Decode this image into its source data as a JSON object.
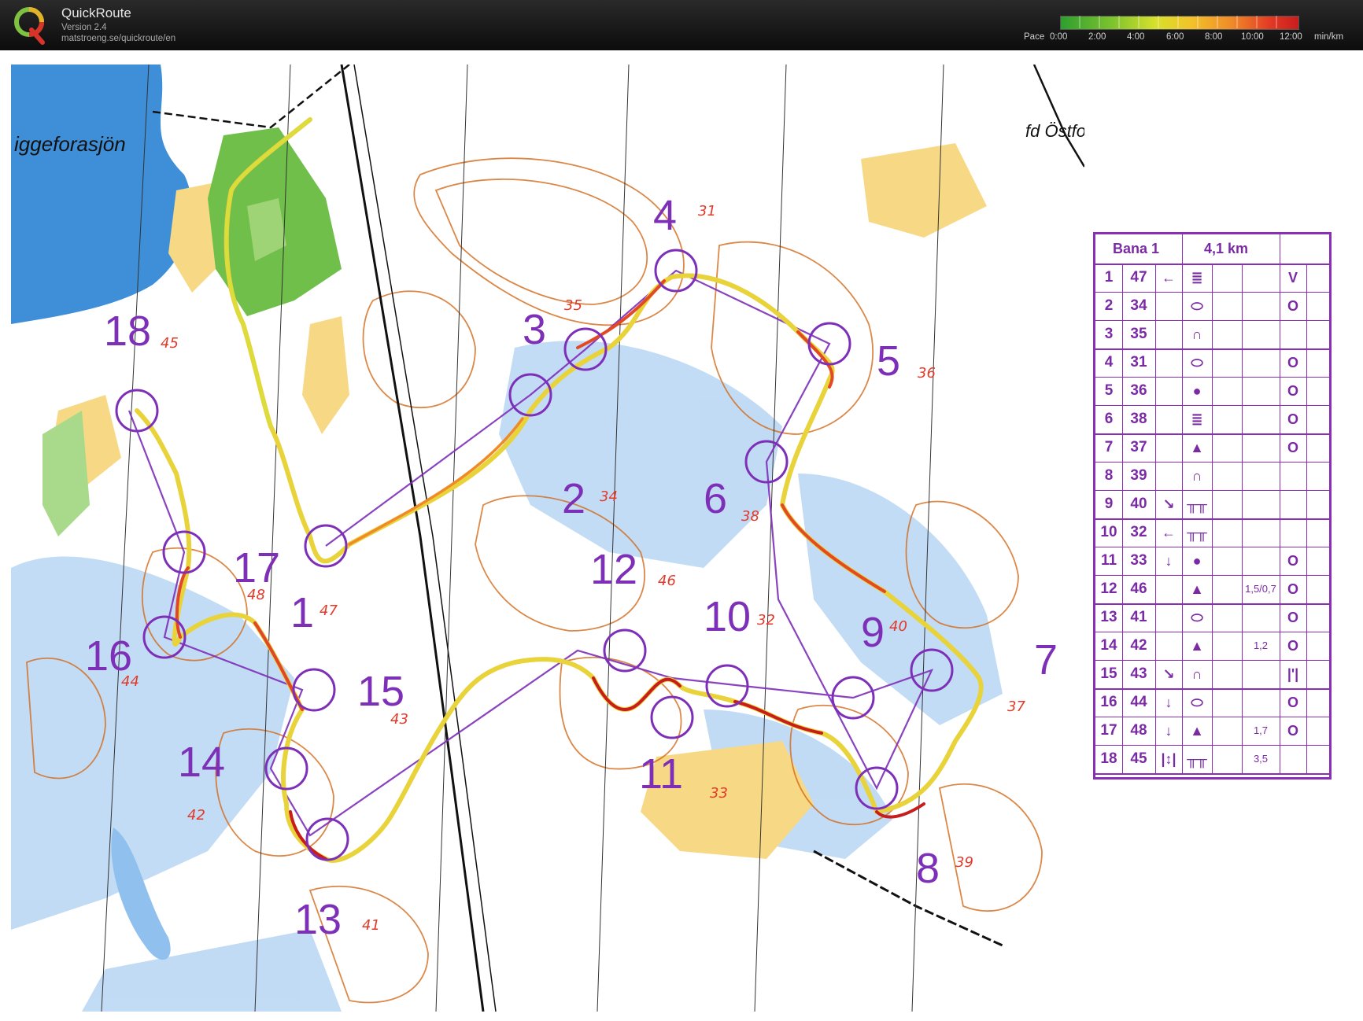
{
  "app": {
    "name": "QuickRoute",
    "version": "Version 2.4",
    "url": "matstroeng.se/quickroute/en"
  },
  "pace_legend": {
    "label": "Pace",
    "ticks": [
      "0:00",
      "2:00",
      "4:00",
      "6:00",
      "8:00",
      "10:00",
      "12:00"
    ],
    "unit": "min/km",
    "colors": [
      "#2f9e2f",
      "#7ec42e",
      "#d8e02b",
      "#f2c22a",
      "#f08a28",
      "#e23a24",
      "#c81d1d"
    ]
  },
  "map": {
    "place_names": [
      "iggeforasjön",
      "fd Östforas"
    ],
    "colors": {
      "water": "#3f8fd8",
      "marsh": "#8fc0ee",
      "open_land": "#f7d985",
      "forest_green": "#6fbf4a",
      "contour": "#d26a1a",
      "course": "#7d2fb8",
      "handwritten": "#e23a2a"
    },
    "controls": [
      {
        "num": "1",
        "code": "47"
      },
      {
        "num": "2",
        "code": "34"
      },
      {
        "num": "3",
        "code": "35"
      },
      {
        "num": "4",
        "code": "31"
      },
      {
        "num": "5",
        "code": "36"
      },
      {
        "num": "6",
        "code": "38"
      },
      {
        "num": "7",
        "code": "37"
      },
      {
        "num": "8",
        "code": "39"
      },
      {
        "num": "9",
        "code": "40"
      },
      {
        "num": "10",
        "code": "32"
      },
      {
        "num": "11",
        "code": "33"
      },
      {
        "num": "12",
        "code": "46"
      },
      {
        "num": "13",
        "code": "41"
      },
      {
        "num": "14",
        "code": "42"
      },
      {
        "num": "15",
        "code": "43"
      },
      {
        "num": "16",
        "code": "44"
      },
      {
        "num": "17",
        "code": "48"
      },
      {
        "num": "18",
        "code": "45"
      }
    ]
  },
  "description_sheet": {
    "course_name": "Bana 1",
    "length": "4,1 km",
    "rows": [
      {
        "num": "1",
        "code": "47",
        "dir": "←",
        "feature": "≣",
        "where": "V"
      },
      {
        "num": "2",
        "code": "34",
        "dir": "",
        "feature": "⬭",
        "where": "O"
      },
      {
        "num": "3",
        "code": "35",
        "dir": "",
        "feature": "∩",
        "where": ""
      },
      {
        "num": "4",
        "code": "31",
        "dir": "",
        "feature": "⬭",
        "where": "O"
      },
      {
        "num": "5",
        "code": "36",
        "dir": "",
        "feature": "●",
        "where": "O"
      },
      {
        "num": "6",
        "code": "38",
        "dir": "",
        "feature": "≣",
        "where": "O"
      },
      {
        "num": "7",
        "code": "37",
        "dir": "",
        "feature": "▲",
        "where": "O"
      },
      {
        "num": "8",
        "code": "39",
        "dir": "",
        "feature": "∩",
        "where": ""
      },
      {
        "num": "9",
        "code": "40",
        "dir": "↘",
        "feature": "╥╥",
        "where": ""
      },
      {
        "num": "10",
        "code": "32",
        "dir": "←",
        "feature": "╥╥",
        "where": ""
      },
      {
        "num": "11",
        "code": "33",
        "dir": "↓",
        "feature": "●",
        "where": "O"
      },
      {
        "num": "12",
        "code": "46",
        "dir": "",
        "feature": "▲",
        "size": "1,5/0,7",
        "where": "O"
      },
      {
        "num": "13",
        "code": "41",
        "dir": "",
        "feature": "⬭",
        "where": "O"
      },
      {
        "num": "14",
        "code": "42",
        "dir": "",
        "feature": "▲",
        "size": "1,2",
        "where": "O"
      },
      {
        "num": "15",
        "code": "43",
        "dir": "↘",
        "feature": "∩",
        "where": "|'|"
      },
      {
        "num": "16",
        "code": "44",
        "dir": "↓",
        "feature": "⬭",
        "where": "O"
      },
      {
        "num": "17",
        "code": "48",
        "dir": "↓",
        "feature": "▲",
        "size": "1,7",
        "where": "O"
      },
      {
        "num": "18",
        "code": "45",
        "dir": "|↕|",
        "feature": "╥╥",
        "size": "3,5",
        "where": ""
      }
    ]
  }
}
